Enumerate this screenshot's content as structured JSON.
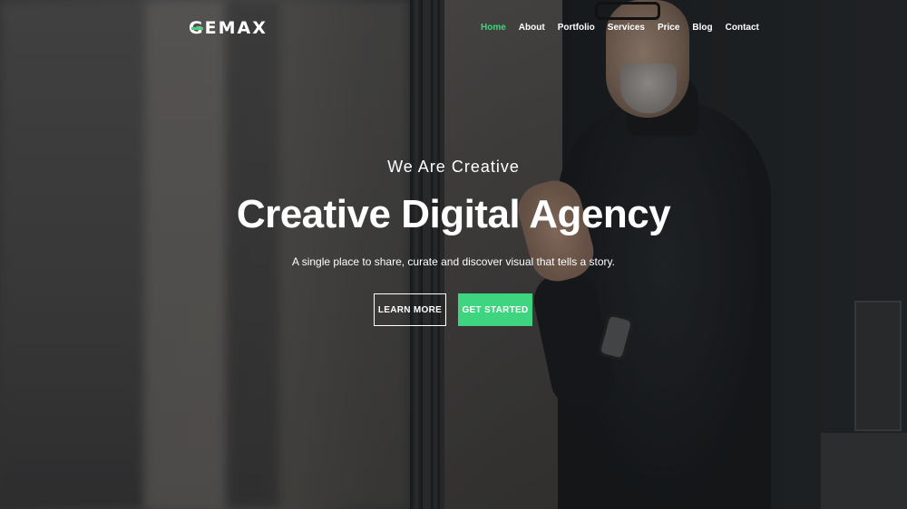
{
  "header": {
    "logo_mark": "G",
    "logo_rest": "EMAX",
    "nav": [
      {
        "label": "Home",
        "active": true
      },
      {
        "label": "About",
        "active": false
      },
      {
        "label": "Portfolio",
        "active": false
      },
      {
        "label": "Services",
        "active": false
      },
      {
        "label": "Price",
        "active": false
      },
      {
        "label": "Blog",
        "active": false
      },
      {
        "label": "Contact",
        "active": false
      }
    ]
  },
  "hero": {
    "tagline": "We Are Creative",
    "headline": "Creative Digital Agency",
    "subline": "A single place to share, curate and discover visual that tells a story.",
    "learn_more_label": "LEARN MORE",
    "get_started_label": "GET STARTED"
  },
  "colors": {
    "accent": "#3fd47f",
    "text": "#ffffff"
  }
}
